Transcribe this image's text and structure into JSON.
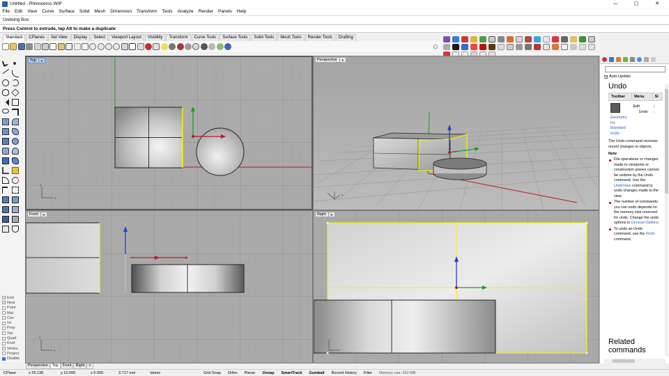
{
  "window": {
    "title": "Untitled - Rhinoceros WIP",
    "minimize": "—",
    "maximize": "▢",
    "close": "✕"
  },
  "menu": [
    "File",
    "Edit",
    "View",
    "Curve",
    "Surface",
    "Solid",
    "Mesh",
    "Dimension",
    "Transform",
    "Tools",
    "Analyze",
    "Render",
    "Panels",
    "Help"
  ],
  "history": "Undoing Box",
  "command_prompt": "Press Control to extrude, tap Alt to make a duplicate",
  "toolbar_tabs": [
    "Standard",
    "CPlanes",
    "Set View",
    "Display",
    "Select",
    "Viewport Layout",
    "Visibility",
    "Transform",
    "Curve Tools",
    "Surface Tools",
    "Solid Tools",
    "Mesh Tools",
    "Render Tools",
    "Drafting"
  ],
  "active_toolbar_tab": "Standard",
  "viewports": {
    "top": "Top",
    "perspective": "Perspective",
    "front": "Front",
    "right": "Right",
    "active": "Top"
  },
  "viewport_tabs": [
    "Perspective",
    "Top",
    "Front",
    "Right"
  ],
  "viewport_tab_add": "+",
  "axis_labels": {
    "x": "x",
    "y": "y",
    "z": "z"
  },
  "osnaps": [
    {
      "label": "End",
      "checked": true
    },
    {
      "label": "Near",
      "checked": true
    },
    {
      "label": "Point",
      "checked": false
    },
    {
      "label": "Mid",
      "checked": false
    },
    {
      "label": "Cen",
      "checked": false
    },
    {
      "label": "Int",
      "checked": false
    },
    {
      "label": "Perp",
      "checked": false
    },
    {
      "label": "Tan",
      "checked": false
    },
    {
      "label": "Quad",
      "checked": false
    },
    {
      "label": "Knot",
      "checked": false
    },
    {
      "label": "Vertex",
      "checked": false
    },
    {
      "label": "Project",
      "checked": false
    },
    {
      "label": "Disable",
      "checked": false
    }
  ],
  "status": {
    "cplane": "CPlane",
    "x": "x 26.138",
    "y": "y 10.000",
    "z": "z 5.000",
    "dist": "3.717 mm",
    "layer": "Varies",
    "grid_snap": "Grid Snap",
    "ortho": "Ortho",
    "planar": "Planar",
    "osnap": "Osnap",
    "smarttrack": "SmartTrack",
    "gumball": "Gumball",
    "record_history": "Record History",
    "filter": "Filter",
    "memory": "Memory use: 532 MB"
  },
  "help_panel": {
    "auto_update": "Auto-Update",
    "title": "Undo",
    "table_headers": [
      "Toolbar",
      "Menu",
      "Sl"
    ],
    "menu_values": [
      "Edit",
      "Undo"
    ],
    "trunc_values": [
      "(",
      ";"
    ],
    "toolbar_links": [
      "Geometry",
      "Fix",
      "Standard",
      "Undo"
    ],
    "description": "The Undo command reverses recent changes to objects.",
    "note_heading": "Note",
    "notes": [
      {
        "pre": "File operations or changes made to viewports or construction planes cannot be undone by the Undo command. Use the ",
        "link": "UndoView",
        "post": " command to undo changes made to the view."
      },
      {
        "pre": "The number of commands you can undo depends on the memory size reserved for undo. Change the undo options in ",
        "link": "General Options",
        "post": "."
      },
      {
        "pre": "To undo an Undo command, use the ",
        "link": "Redo",
        "post": " command."
      }
    ],
    "related_heading": "Related commands"
  },
  "colors": {
    "viewport_bg": "#a9a9a9",
    "grid_minor": "#9b9b9b",
    "grid_major": "#8c8c8c",
    "selection": "#f3f300",
    "x_axis": "#c4161c",
    "y_axis": "#18a018",
    "z_axis": "#1f3ed6"
  }
}
